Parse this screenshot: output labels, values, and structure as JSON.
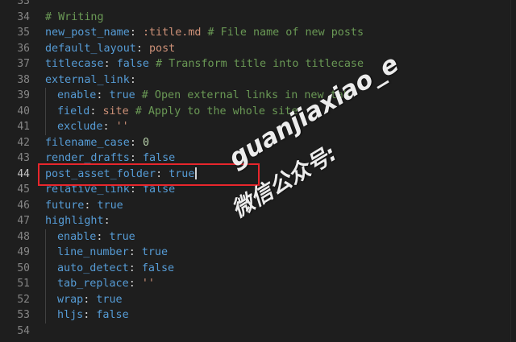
{
  "editor": {
    "active_line": "44",
    "lines": [
      {
        "n": "33",
        "indent": 0,
        "tokens": []
      },
      {
        "n": "34",
        "indent": 0,
        "tokens": [
          {
            "t": "# Writing",
            "c": "comment"
          }
        ]
      },
      {
        "n": "35",
        "indent": 0,
        "tokens": [
          {
            "t": "new_post_name",
            "c": "key"
          },
          {
            "t": ": ",
            "c": "colon"
          },
          {
            "t": ":title.md",
            "c": "str"
          },
          {
            "t": " # File name of new posts",
            "c": "comment"
          }
        ]
      },
      {
        "n": "36",
        "indent": 0,
        "tokens": [
          {
            "t": "default_layout",
            "c": "key"
          },
          {
            "t": ": ",
            "c": "colon"
          },
          {
            "t": "post",
            "c": "str"
          }
        ]
      },
      {
        "n": "37",
        "indent": 0,
        "tokens": [
          {
            "t": "titlecase",
            "c": "key"
          },
          {
            "t": ": ",
            "c": "colon"
          },
          {
            "t": "false",
            "c": "bool"
          },
          {
            "t": " # Transform title into titlecase",
            "c": "comment"
          }
        ]
      },
      {
        "n": "38",
        "indent": 0,
        "tokens": [
          {
            "t": "external_link",
            "c": "key"
          },
          {
            "t": ":",
            "c": "colon"
          }
        ]
      },
      {
        "n": "39",
        "indent": 1,
        "tokens": [
          {
            "t": "enable",
            "c": "key"
          },
          {
            "t": ": ",
            "c": "colon"
          },
          {
            "t": "true",
            "c": "bool"
          },
          {
            "t": " # Open external links in new tab",
            "c": "comment"
          }
        ]
      },
      {
        "n": "40",
        "indent": 1,
        "tokens": [
          {
            "t": "field",
            "c": "key"
          },
          {
            "t": ": ",
            "c": "colon"
          },
          {
            "t": "site",
            "c": "str"
          },
          {
            "t": " # Apply to the whole site",
            "c": "comment"
          }
        ]
      },
      {
        "n": "41",
        "indent": 1,
        "tokens": [
          {
            "t": "exclude",
            "c": "key"
          },
          {
            "t": ": ",
            "c": "colon"
          },
          {
            "t": "''",
            "c": "str"
          }
        ]
      },
      {
        "n": "42",
        "indent": 0,
        "tokens": [
          {
            "t": "filename_case",
            "c": "key"
          },
          {
            "t": ": ",
            "c": "colon"
          },
          {
            "t": "0",
            "c": "num"
          }
        ]
      },
      {
        "n": "43",
        "indent": 0,
        "tokens": [
          {
            "t": "render_drafts",
            "c": "key"
          },
          {
            "t": ": ",
            "c": "colon"
          },
          {
            "t": "false",
            "c": "bool"
          }
        ]
      },
      {
        "n": "44",
        "indent": 0,
        "tokens": [
          {
            "t": "post_asset_folder",
            "c": "key"
          },
          {
            "t": ": ",
            "c": "colon"
          },
          {
            "t": "true",
            "c": "bool"
          }
        ],
        "cursor": true
      },
      {
        "n": "45",
        "indent": 0,
        "tokens": [
          {
            "t": "relative_link",
            "c": "key"
          },
          {
            "t": ": ",
            "c": "colon"
          },
          {
            "t": "false",
            "c": "bool"
          }
        ]
      },
      {
        "n": "46",
        "indent": 0,
        "tokens": [
          {
            "t": "future",
            "c": "key"
          },
          {
            "t": ": ",
            "c": "colon"
          },
          {
            "t": "true",
            "c": "bool"
          }
        ]
      },
      {
        "n": "47",
        "indent": 0,
        "tokens": [
          {
            "t": "highlight",
            "c": "key"
          },
          {
            "t": ":",
            "c": "colon"
          }
        ]
      },
      {
        "n": "48",
        "indent": 1,
        "tokens": [
          {
            "t": "enable",
            "c": "key"
          },
          {
            "t": ": ",
            "c": "colon"
          },
          {
            "t": "true",
            "c": "bool"
          }
        ]
      },
      {
        "n": "49",
        "indent": 1,
        "tokens": [
          {
            "t": "line_number",
            "c": "key"
          },
          {
            "t": ": ",
            "c": "colon"
          },
          {
            "t": "true",
            "c": "bool"
          }
        ]
      },
      {
        "n": "50",
        "indent": 1,
        "tokens": [
          {
            "t": "auto_detect",
            "c": "key"
          },
          {
            "t": ": ",
            "c": "colon"
          },
          {
            "t": "false",
            "c": "bool"
          }
        ]
      },
      {
        "n": "51",
        "indent": 1,
        "tokens": [
          {
            "t": "tab_replace",
            "c": "key"
          },
          {
            "t": ": ",
            "c": "colon"
          },
          {
            "t": "''",
            "c": "str"
          }
        ]
      },
      {
        "n": "52",
        "indent": 1,
        "tokens": [
          {
            "t": "wrap",
            "c": "key"
          },
          {
            "t": ": ",
            "c": "colon"
          },
          {
            "t": "true",
            "c": "bool"
          }
        ]
      },
      {
        "n": "53",
        "indent": 1,
        "tokens": [
          {
            "t": "hljs",
            "c": "key"
          },
          {
            "t": ": ",
            "c": "colon"
          },
          {
            "t": "false",
            "c": "bool"
          }
        ]
      },
      {
        "n": "54",
        "indent": 0,
        "tokens": []
      }
    ]
  },
  "watermark": {
    "line1": "guanjiaxiao_e",
    "line2": "微信公众号:"
  },
  "colors": {
    "background": "#1e1e1e",
    "key": "#569cd6",
    "string": "#ce9178",
    "comment": "#6a9955",
    "number": "#b5cea8",
    "highlight_box": "#e8262c"
  }
}
